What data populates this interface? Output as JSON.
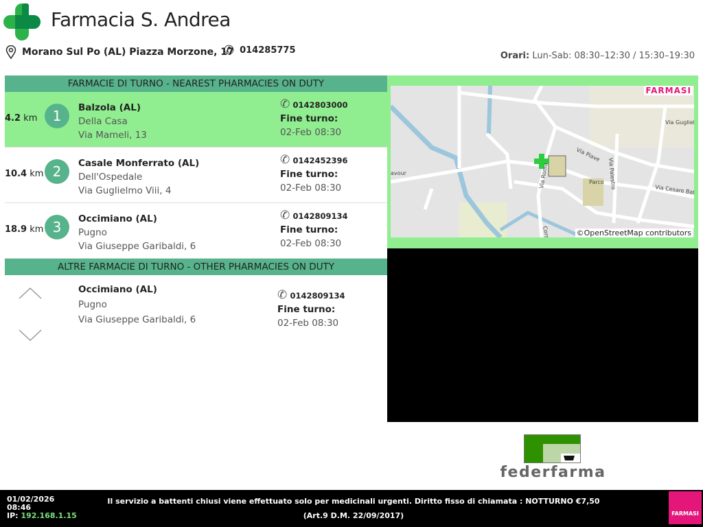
{
  "header": {
    "title": "Farmacia S. Andrea",
    "address": "Morano Sul Po (AL) Piazza Morzone, 17",
    "phone": "014285775",
    "hours_label": "Orari:",
    "hours": "Lun-Sab: 08:30–12:30 / 15:30–19:30"
  },
  "nearest": {
    "title": "FARMACIE DI TURNO - NEAREST PHARMACIES ON DUTY",
    "items": [
      {
        "dist": "4.2",
        "unit": "km",
        "num": "1",
        "city": "Balzola (AL)",
        "name": "Della Casa",
        "street": "Via Mameli, 13",
        "phone": "0142803000",
        "end_label": "Fine turno:",
        "end": "02-Feb 08:30"
      },
      {
        "dist": "10.4",
        "unit": "km",
        "num": "2",
        "city": "Casale Monferrato (AL)",
        "name": "Dell'Ospedale",
        "street": "Via Guglielmo Viii, 4",
        "phone": "0142452396",
        "end_label": "Fine turno:",
        "end": "02-Feb 08:30"
      },
      {
        "dist": "18.9",
        "unit": "km",
        "num": "3",
        "city": "Occimiano (AL)",
        "name": "Pugno",
        "street": "Via Giuseppe Garibaldi, 6",
        "phone": "0142809134",
        "end_label": "Fine turno:",
        "end": "02-Feb 08:30"
      }
    ]
  },
  "other": {
    "title": "ALTRE FARMACIE DI TURNO - OTHER PHARMACIES ON DUTY",
    "items": [
      {
        "city": "Occimiano (AL)",
        "name": "Pugno",
        "street": "Via Giuseppe Garibaldi, 6",
        "phone": "0142809134",
        "end_label": "Fine turno:",
        "end": "02-Feb 08:30"
      }
    ]
  },
  "map": {
    "brand": "FARMASI",
    "attribution": "©OpenStreetMap contributors",
    "streets": [
      "Via Piave",
      "Via Palestro",
      "Via Guglielmo",
      "Via Cesare Battisti",
      "avour",
      "Via Roma",
      "Corso",
      "Parco"
    ]
  },
  "federfarma": "federfarma",
  "footer": {
    "date": "01/02/2026",
    "time": "08:46",
    "ip_label": "IP:",
    "ip": "192.168.1.15",
    "notice": "Il servizio a battenti chiusi viene effettuato solo per medicinali urgenti. Diritto fisso di chiamata : NOTTURNO €7,50 (Art.9 D.M. 22/09/2017)",
    "badge": "FARMASI"
  }
}
